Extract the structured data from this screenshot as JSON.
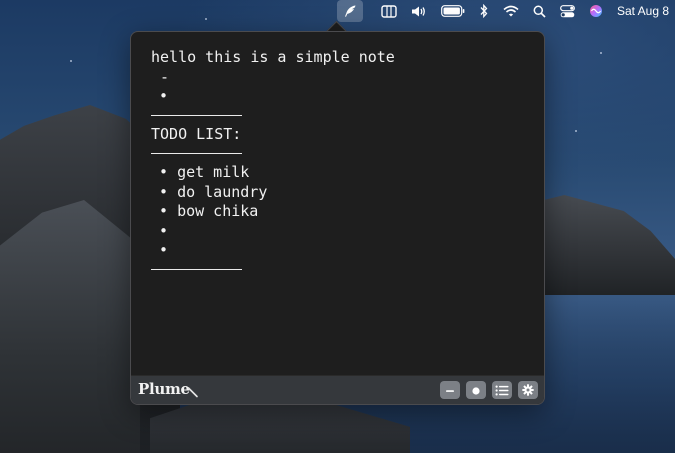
{
  "menubar": {
    "clock": "Sat Aug 8",
    "icons": [
      "plume-quill-icon",
      "sidebar-window-icon",
      "volume-icon",
      "battery-icon",
      "bluetooth-icon",
      "wifi-icon",
      "spotlight-search-icon",
      "control-center-icon",
      "siri-icon"
    ]
  },
  "note": {
    "line1": "hello this is a simple note",
    "line2": "-",
    "line3": "•",
    "heading": "TODO LIST:",
    "todo": [
      "get milk",
      "do laundry",
      "bow chika",
      "",
      ""
    ],
    "bullet_glyph": "•"
  },
  "footer": {
    "brand": "Plume",
    "buttons": [
      "minus-icon",
      "circle-dot-icon",
      "list-icon",
      "gear-icon"
    ]
  },
  "colors": {
    "popover_bg": "#1e1e1e",
    "footer_bg": "#35383c",
    "button_bg": "#7c8086",
    "text": "#f1f1f1"
  }
}
